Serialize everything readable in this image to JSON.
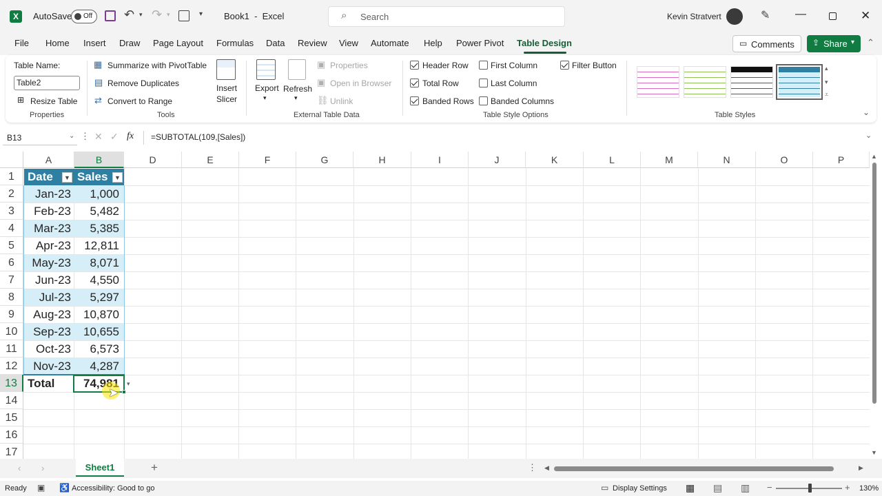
{
  "titlebar": {
    "autosave_label": "AutoSave",
    "autosave_state": "Off",
    "doc_title": "Book1  -  Excel",
    "search_placeholder": "Search",
    "user_name": "Kevin Stratvert"
  },
  "tabs": [
    "File",
    "Home",
    "Insert",
    "Draw",
    "Page Layout",
    "Formulas",
    "Data",
    "Review",
    "View",
    "Automate",
    "Help",
    "Power Pivot",
    "Table Design"
  ],
  "actions": {
    "comments": "Comments",
    "share": "Share"
  },
  "ribbon": {
    "properties": {
      "table_name_label": "Table Name:",
      "table_name_value": "Table2",
      "resize": "Resize Table",
      "group": "Properties"
    },
    "tools": {
      "summarize": "Summarize with PivotTable",
      "remove_dup": "Remove Duplicates",
      "convert": "Convert to Range",
      "insert_slicer_1": "Insert",
      "insert_slicer_2": "Slicer",
      "group": "Tools"
    },
    "external": {
      "export": "Export",
      "refresh": "Refresh",
      "properties": "Properties",
      "open_browser": "Open in Browser",
      "unlink": "Unlink",
      "group": "External Table Data"
    },
    "style_options": {
      "header_row": "Header Row",
      "total_row": "Total Row",
      "banded_rows": "Banded Rows",
      "first_column": "First Column",
      "last_column": "Last Column",
      "banded_columns": "Banded Columns",
      "filter_button": "Filter Button",
      "group": "Table Style Options"
    },
    "styles": {
      "group": "Table Styles"
    }
  },
  "formula_bar": {
    "name_box": "B13",
    "fx": "fx",
    "formula": "=SUBTOTAL(109,[Sales])"
  },
  "columns": [
    "A",
    "B",
    "D",
    "E",
    "F",
    "G",
    "H",
    "I",
    "J",
    "K",
    "L",
    "M",
    "N",
    "O",
    "P"
  ],
  "rows": [
    "1",
    "2",
    "3",
    "4",
    "5",
    "6",
    "7",
    "8",
    "9",
    "10",
    "11",
    "12",
    "13",
    "14",
    "15",
    "16",
    "17"
  ],
  "table": {
    "headers": [
      "Date",
      "Sales"
    ],
    "data": [
      [
        "Jan-23",
        "1,000"
      ],
      [
        "Feb-23",
        "5,482"
      ],
      [
        "Mar-23",
        "5,385"
      ],
      [
        "Apr-23",
        "12,811"
      ],
      [
        "May-23",
        "8,071"
      ],
      [
        "Jun-23",
        "4,550"
      ],
      [
        "Jul-23",
        "5,297"
      ],
      [
        "Aug-23",
        "10,870"
      ],
      [
        "Sep-23",
        "10,655"
      ],
      [
        "Oct-23",
        "6,573"
      ],
      [
        "Nov-23",
        "4,287"
      ]
    ],
    "total_label": "Total",
    "total_value": "74,981"
  },
  "sheet": {
    "tab": "Sheet1",
    "add": "+"
  },
  "status": {
    "ready": "Ready",
    "accessibility": "Accessibility: Good to go",
    "display_settings": "Display Settings",
    "zoom": "130%"
  },
  "colors": {
    "excel_green": "#185c37",
    "band": "#d6eef8",
    "header": "#2f7fa3"
  }
}
